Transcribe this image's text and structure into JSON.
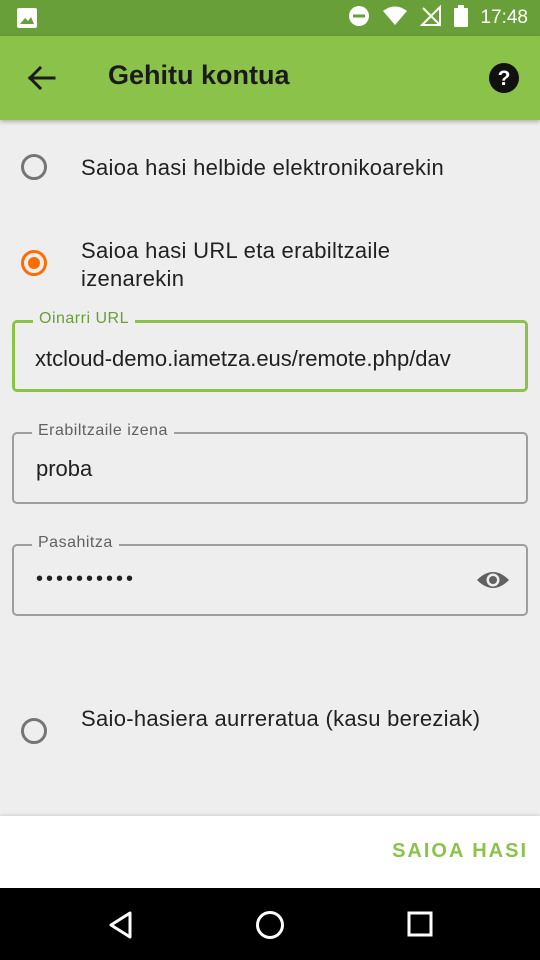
{
  "status_bar": {
    "time": "17:48",
    "icons": [
      "image-icon",
      "do-not-disturb-icon",
      "wifi-icon",
      "no-signal-icon",
      "battery-icon"
    ]
  },
  "app_bar": {
    "title": "Gehitu kontua",
    "back_icon": "arrow-back-icon",
    "help_icon": "help-icon"
  },
  "login_options": [
    {
      "label": "Saioa hasi helbide elektronikoarekin",
      "selected": false
    },
    {
      "label": "Saioa hasi URL eta erabiltzaile izenarekin",
      "selected": true
    },
    {
      "label": "Saio-hasiera aurreratua (kasu bereziak)",
      "selected": false
    }
  ],
  "fields": {
    "base_url": {
      "label": "Oinarri URL",
      "value": "xtcloud-demo.iametza.eus/remote.php/dav"
    },
    "username": {
      "label": "Erabiltzaile izena",
      "value": "proba"
    },
    "password": {
      "label": "Pasahitza",
      "value": "••••••••••",
      "toggle_icon": "eye-icon"
    }
  },
  "actions": {
    "login": "SAIOA HASI"
  },
  "colors": {
    "status_bar": "#689f38",
    "app_bar": "#8bc34a",
    "accent": "#ff6d00",
    "action_text": "#8bc34a"
  }
}
